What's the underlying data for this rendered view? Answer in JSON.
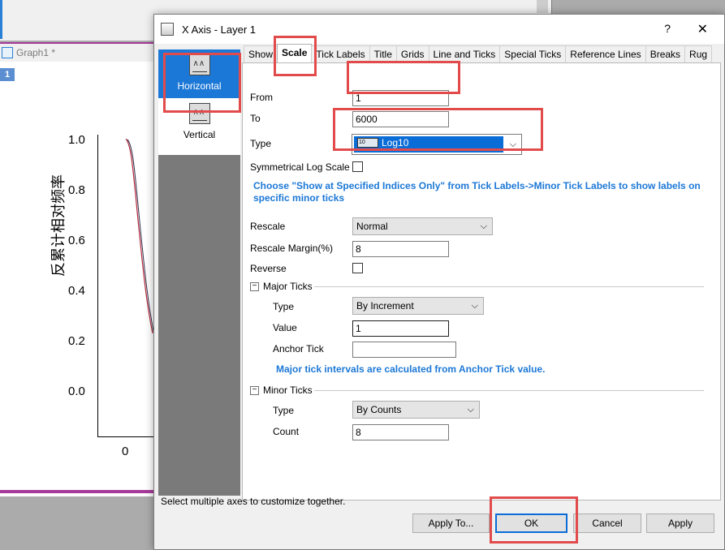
{
  "background": {
    "graph_window_title": "Graph1 *",
    "layer_tag": "1",
    "y_axis_label": "反累计相对频率",
    "y_ticks": [
      "1.0",
      "0.8",
      "0.6",
      "0.4",
      "0.2",
      "0.0"
    ],
    "x_tick": "0"
  },
  "dialog": {
    "title": "X Axis - Layer 1",
    "help": "?",
    "close": "✕"
  },
  "sidebar": {
    "items": [
      {
        "label": "Horizontal"
      },
      {
        "label": "Vertical"
      }
    ]
  },
  "tabs": [
    "Show",
    "Scale",
    "Tick Labels",
    "Title",
    "Grids",
    "Line and Ticks",
    "Special Ticks",
    "Reference Lines",
    "Breaks",
    "Rug"
  ],
  "scale": {
    "from_label": "From",
    "from_value": "1",
    "to_label": "To",
    "to_value": "6000",
    "type_label": "Type",
    "type_value": "Log10",
    "type_icon_text": "10",
    "symmetrical_label": "Symmetrical Log Scale",
    "hint1": "Choose \"Show at Specified Indices Only\" from Tick Labels->Minor Tick Labels to show labels on",
    "hint1b": "specific minor ticks",
    "rescale_label": "Rescale",
    "rescale_value": "Normal",
    "rescale_margin_label": "Rescale Margin(%)",
    "rescale_margin_value": "8",
    "reverse_label": "Reverse"
  },
  "major": {
    "section": "Major Ticks",
    "type_label": "Type",
    "type_value": "By Increment",
    "value_label": "Value",
    "value_value": "1",
    "anchor_label": "Anchor Tick",
    "anchor_value": "",
    "hint": "Major tick intervals are calculated from Anchor Tick value."
  },
  "minor": {
    "section": "Minor Ticks",
    "type_label": "Type",
    "type_value": "By Counts",
    "count_label": "Count",
    "count_value": "8"
  },
  "footer": {
    "status": "Select multiple axes to customize together.",
    "apply_to": "Apply To...",
    "ok": "OK",
    "cancel": "Cancel",
    "apply": "Apply"
  },
  "colors": {
    "accent": "#1c78d6",
    "hint": "#1c78d6",
    "highlight": "#e24b4b",
    "curve_red": "#b3283a"
  }
}
